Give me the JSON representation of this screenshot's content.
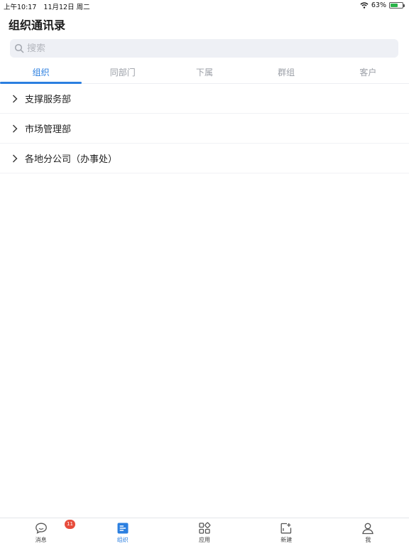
{
  "status_bar": {
    "time": "上午10:17",
    "date": "11月12日 周二",
    "battery_percent": "63%",
    "battery_level": 0.63,
    "battery_color": "#2bb34a"
  },
  "header": {
    "title": "组织通讯录"
  },
  "search": {
    "placeholder": "搜索",
    "value": ""
  },
  "tabs": [
    {
      "label": "组织",
      "active": true
    },
    {
      "label": "同部门",
      "active": false
    },
    {
      "label": "下属",
      "active": false
    },
    {
      "label": "群组",
      "active": false
    },
    {
      "label": "客户",
      "active": false
    }
  ],
  "departments": [
    {
      "label": "支撑服务部"
    },
    {
      "label": "市场管理部"
    },
    {
      "label": "各地分公司（办事处）"
    }
  ],
  "bottom_nav": [
    {
      "label": "消息",
      "icon": "chat-bubble-icon",
      "badge": "11"
    },
    {
      "label": "组织",
      "icon": "org-icon",
      "active": true
    },
    {
      "label": "应用",
      "icon": "apps-grid-icon"
    },
    {
      "label": "新建",
      "icon": "new-doc-icon"
    },
    {
      "label": "我",
      "icon": "person-icon"
    }
  ],
  "colors": {
    "accent": "#2b7fe0",
    "badge": "#e74c3c",
    "search_bg": "#eef0f5"
  }
}
